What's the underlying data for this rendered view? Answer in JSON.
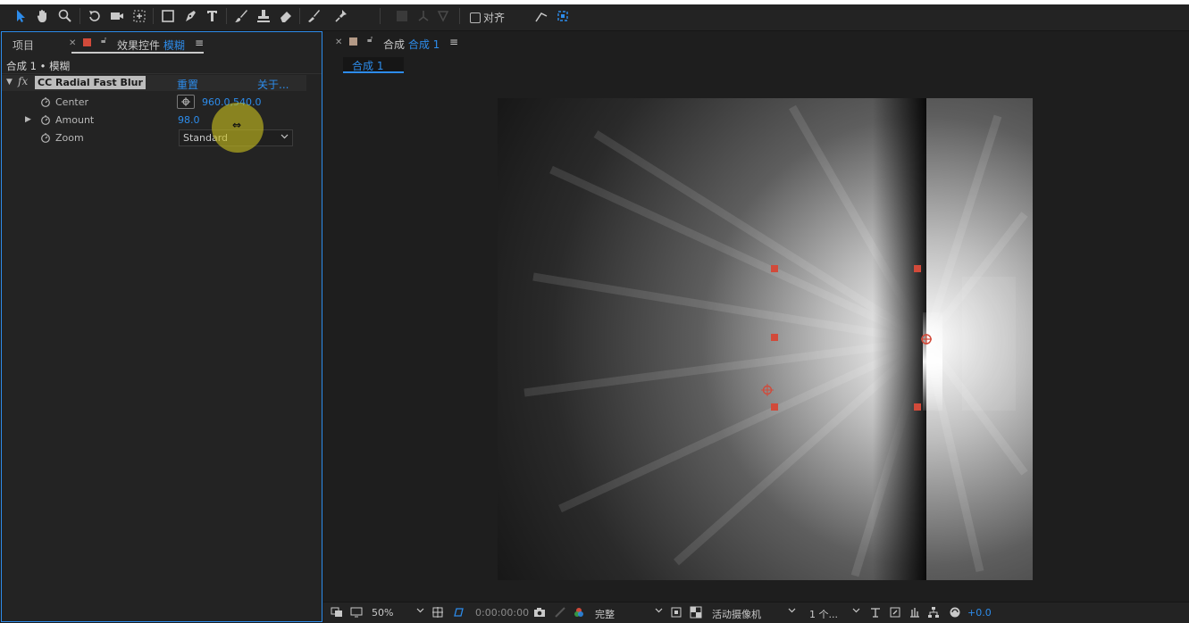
{
  "toolbar": {
    "tools": [
      "selection-tool",
      "hand-tool",
      "zoom-tool",
      "rotation-tool",
      "camera-tool",
      "pan-behind-tool",
      "rectangle-tool",
      "pen-tool",
      "type-tool",
      "brush-tool",
      "clone-stamp-tool",
      "eraser-tool",
      "roto-brush-tool",
      "puppet-pin-tool"
    ],
    "snap_label": "对齐"
  },
  "left_panel": {
    "tab_project": "项目",
    "tab_effects_prefix": "效果控件",
    "tab_effects_layer": "模糊",
    "subtitle": "合成 1 • 模糊",
    "effect": {
      "name": "CC Radial Fast Blur",
      "reset_label": "重置",
      "about_label": "关于..."
    },
    "properties": {
      "center": {
        "name": "Center",
        "value": "960.0,540.0"
      },
      "amount": {
        "name": "Amount",
        "value": "98.0"
      },
      "zoom": {
        "name": "Zoom",
        "value": "Standard"
      }
    }
  },
  "right_panel": {
    "tab_prefix": "合成",
    "tab_comp": "合成 1",
    "comp_chip": "合成 1",
    "viewer_toolbar": {
      "zoom": "50%",
      "timecode": "0:00:00:00",
      "resolution": "完整",
      "camera": "活动摄像机",
      "views": "1 个...",
      "exposure": "+0.0"
    }
  },
  "colors": {
    "accent": "#2d8ceb",
    "label_red": "#d24a3a",
    "label_tan": "#b49a86"
  }
}
